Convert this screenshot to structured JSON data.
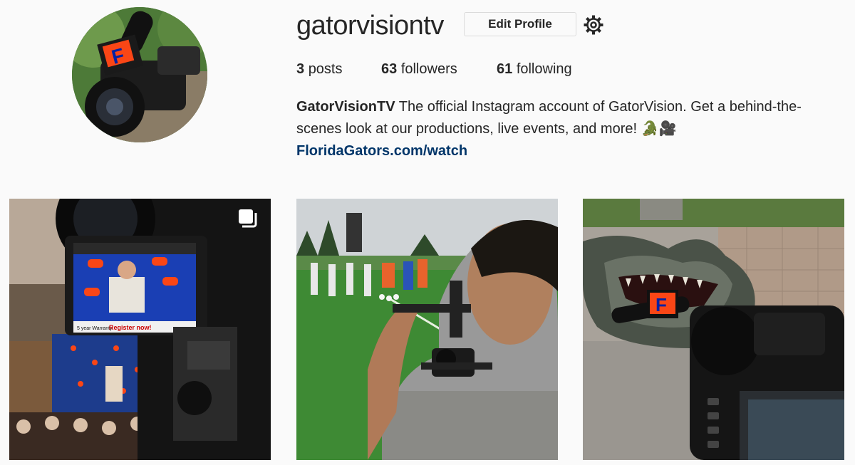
{
  "profile": {
    "username": "gatorvisiontv",
    "edit_profile_label": "Edit Profile",
    "settings_icon": "gear-icon",
    "avatar_icon": "camera-microphone-avatar"
  },
  "stats": {
    "posts_count": "3",
    "posts_label": "posts",
    "followers_count": "63",
    "followers_label": "followers",
    "following_count": "61",
    "following_label": "following"
  },
  "bio": {
    "name": "GatorVisionTV",
    "text": "The official Instagram account of GatorVision. Get a behind-the-scenes look at our productions, live events, and more! 🐊🎥",
    "link": "FloridaGators.com/watch"
  },
  "posts": [
    {
      "type": "multiple",
      "icon": "multiple-posts-icon",
      "monitor_text": "Register now!",
      "warranty_text": "5 year Warranty"
    },
    {
      "type": "single"
    },
    {
      "type": "single",
      "mic_flag_letter": "F"
    }
  ],
  "colors": {
    "link": "#003569",
    "border": "#dbdbdb",
    "gator_orange": "#fa4616",
    "gator_blue": "#0021a5"
  }
}
